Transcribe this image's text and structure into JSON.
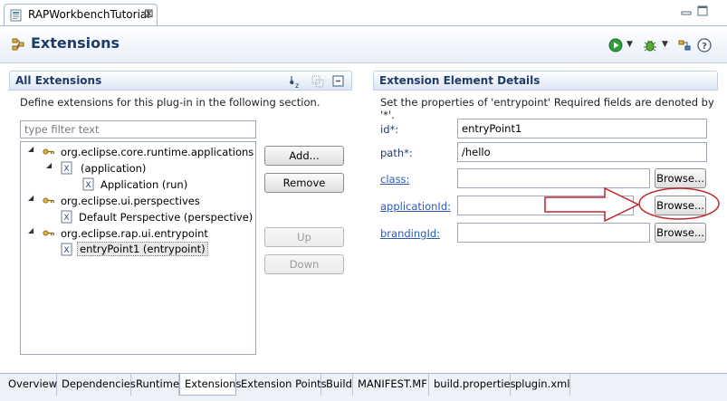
{
  "editor": {
    "tab_title": "RAPWorkbenchTutorial",
    "close_glyph": "⊠"
  },
  "header": {
    "title": "Extensions",
    "toolbar_icons": [
      "run-icon",
      "debug-icon",
      "extension-icon",
      "help-icon"
    ]
  },
  "all_extensions": {
    "title": "All Extensions",
    "description": "Define extensions for this plug-in in the following section.",
    "filter_placeholder": "type filter text",
    "tree": [
      {
        "label": "org.eclipse.core.runtime.applications",
        "kind": "extension",
        "expanded": true
      },
      {
        "label": "(application)",
        "kind": "element",
        "expanded": true
      },
      {
        "label": "Application (run)",
        "kind": "element"
      },
      {
        "label": "org.eclipse.ui.perspectives",
        "kind": "extension",
        "expanded": true
      },
      {
        "label": "Default Perspective (perspective)",
        "kind": "element"
      },
      {
        "label": "org.eclipse.rap.ui.entrypoint",
        "kind": "extension",
        "expanded": true
      },
      {
        "label": "entryPoint1 (entrypoint)",
        "kind": "element",
        "selected": true
      }
    ],
    "buttons": {
      "add": "Add...",
      "remove": "Remove",
      "up": "Up",
      "down": "Down"
    }
  },
  "details": {
    "title": "Extension Element Details",
    "description": "Set the properties of 'entrypoint' Required fields are denoted by '*'.",
    "fields": {
      "id": {
        "label": "id*:",
        "value": "entryPoint1"
      },
      "path": {
        "label": "path*:",
        "value": "/hello"
      },
      "class": {
        "label": "class:",
        "value": "",
        "browse": "Browse..."
      },
      "applicationId": {
        "label": "applicationId:",
        "value": "",
        "browse": "Browse..."
      },
      "brandingId": {
        "label": "brandingId:",
        "value": "",
        "browse": "Browse..."
      }
    }
  },
  "page_tabs": [
    "Overview",
    "Dependencies",
    "Runtime",
    "Extensions",
    "Extension Points",
    "Build",
    "MANIFEST.MF",
    "build.properties",
    "plugin.xml"
  ],
  "active_tab": "Extensions",
  "colors": {
    "accent_title": "#1d3c6a",
    "link": "#2a5ab8",
    "annotation_red": "#c0272d"
  }
}
